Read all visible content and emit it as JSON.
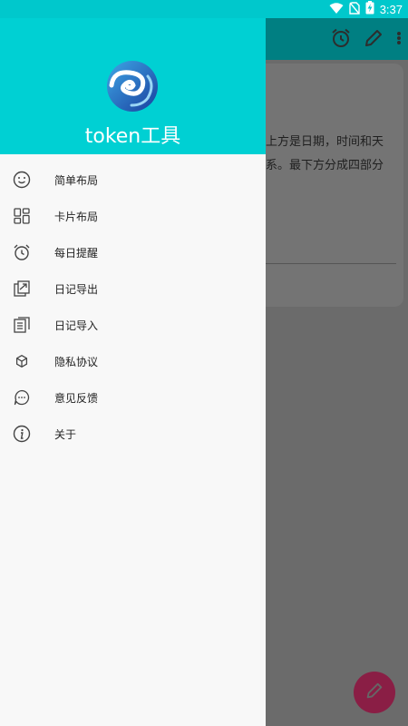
{
  "status_bar": {
    "time": "3:37",
    "icons": [
      "wifi-icon",
      "no-sim-icon",
      "battery-charging-icon"
    ]
  },
  "background": {
    "toolbar_icons": [
      "alarm-icon",
      "pencil-icon",
      "more-vert-icon"
    ],
    "card_text_line1": "上方是日期，时间和天",
    "card_text_line2": "系。最下方分成四部分",
    "fab_icon": "pencil-icon"
  },
  "drawer": {
    "app_name": "token工具",
    "logo_icon": "app-logo",
    "menu": [
      {
        "label": "简单布局",
        "icon": "smiley-icon"
      },
      {
        "label": "卡片布局",
        "icon": "grid-icon"
      },
      {
        "label": "每日提醒",
        "icon": "alarm-icon"
      },
      {
        "label": "日记导出",
        "icon": "export-icon"
      },
      {
        "label": "日记导入",
        "icon": "import-document-icon"
      },
      {
        "label": "隐私协议",
        "icon": "cube-icon"
      },
      {
        "label": "意见反馈",
        "icon": "chat-bubble-icon"
      },
      {
        "label": "关于",
        "icon": "info-icon"
      }
    ]
  },
  "colors": {
    "header": "#00d0d3",
    "status_bar": "#00c8cc",
    "scrim": "#6b6b6b",
    "fab": "#8a1e45"
  }
}
